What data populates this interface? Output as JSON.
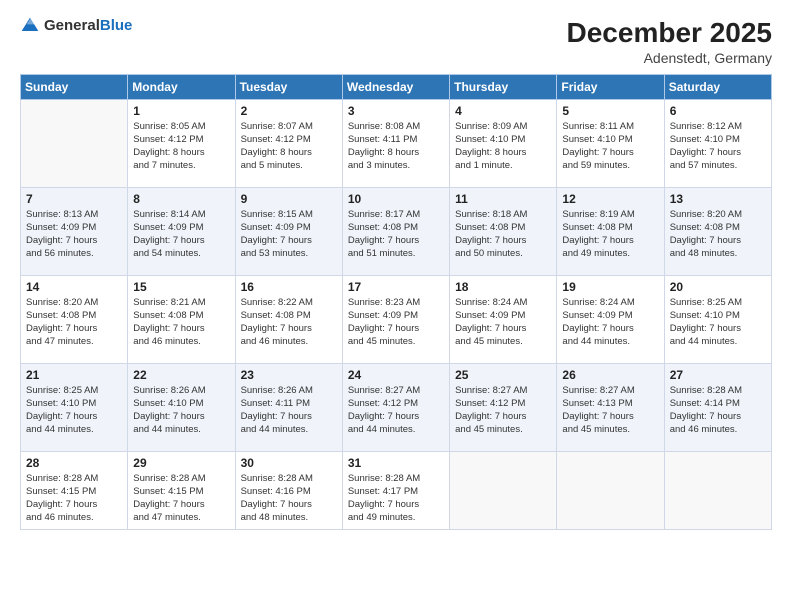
{
  "header": {
    "logo_general": "General",
    "logo_blue": "Blue",
    "title": "December 2025",
    "subtitle": "Adenstedt, Germany"
  },
  "days_of_week": [
    "Sunday",
    "Monday",
    "Tuesday",
    "Wednesday",
    "Thursday",
    "Friday",
    "Saturday"
  ],
  "weeks": [
    [
      {
        "day": "",
        "info": ""
      },
      {
        "day": "1",
        "info": "Sunrise: 8:05 AM\nSunset: 4:12 PM\nDaylight: 8 hours\nand 7 minutes."
      },
      {
        "day": "2",
        "info": "Sunrise: 8:07 AM\nSunset: 4:12 PM\nDaylight: 8 hours\nand 5 minutes."
      },
      {
        "day": "3",
        "info": "Sunrise: 8:08 AM\nSunset: 4:11 PM\nDaylight: 8 hours\nand 3 minutes."
      },
      {
        "day": "4",
        "info": "Sunrise: 8:09 AM\nSunset: 4:10 PM\nDaylight: 8 hours\nand 1 minute."
      },
      {
        "day": "5",
        "info": "Sunrise: 8:11 AM\nSunset: 4:10 PM\nDaylight: 7 hours\nand 59 minutes."
      },
      {
        "day": "6",
        "info": "Sunrise: 8:12 AM\nSunset: 4:10 PM\nDaylight: 7 hours\nand 57 minutes."
      }
    ],
    [
      {
        "day": "7",
        "info": "Sunrise: 8:13 AM\nSunset: 4:09 PM\nDaylight: 7 hours\nand 56 minutes."
      },
      {
        "day": "8",
        "info": "Sunrise: 8:14 AM\nSunset: 4:09 PM\nDaylight: 7 hours\nand 54 minutes."
      },
      {
        "day": "9",
        "info": "Sunrise: 8:15 AM\nSunset: 4:09 PM\nDaylight: 7 hours\nand 53 minutes."
      },
      {
        "day": "10",
        "info": "Sunrise: 8:17 AM\nSunset: 4:08 PM\nDaylight: 7 hours\nand 51 minutes."
      },
      {
        "day": "11",
        "info": "Sunrise: 8:18 AM\nSunset: 4:08 PM\nDaylight: 7 hours\nand 50 minutes."
      },
      {
        "day": "12",
        "info": "Sunrise: 8:19 AM\nSunset: 4:08 PM\nDaylight: 7 hours\nand 49 minutes."
      },
      {
        "day": "13",
        "info": "Sunrise: 8:20 AM\nSunset: 4:08 PM\nDaylight: 7 hours\nand 48 minutes."
      }
    ],
    [
      {
        "day": "14",
        "info": "Sunrise: 8:20 AM\nSunset: 4:08 PM\nDaylight: 7 hours\nand 47 minutes."
      },
      {
        "day": "15",
        "info": "Sunrise: 8:21 AM\nSunset: 4:08 PM\nDaylight: 7 hours\nand 46 minutes."
      },
      {
        "day": "16",
        "info": "Sunrise: 8:22 AM\nSunset: 4:08 PM\nDaylight: 7 hours\nand 46 minutes."
      },
      {
        "day": "17",
        "info": "Sunrise: 8:23 AM\nSunset: 4:09 PM\nDaylight: 7 hours\nand 45 minutes."
      },
      {
        "day": "18",
        "info": "Sunrise: 8:24 AM\nSunset: 4:09 PM\nDaylight: 7 hours\nand 45 minutes."
      },
      {
        "day": "19",
        "info": "Sunrise: 8:24 AM\nSunset: 4:09 PM\nDaylight: 7 hours\nand 44 minutes."
      },
      {
        "day": "20",
        "info": "Sunrise: 8:25 AM\nSunset: 4:10 PM\nDaylight: 7 hours\nand 44 minutes."
      }
    ],
    [
      {
        "day": "21",
        "info": "Sunrise: 8:25 AM\nSunset: 4:10 PM\nDaylight: 7 hours\nand 44 minutes."
      },
      {
        "day": "22",
        "info": "Sunrise: 8:26 AM\nSunset: 4:10 PM\nDaylight: 7 hours\nand 44 minutes."
      },
      {
        "day": "23",
        "info": "Sunrise: 8:26 AM\nSunset: 4:11 PM\nDaylight: 7 hours\nand 44 minutes."
      },
      {
        "day": "24",
        "info": "Sunrise: 8:27 AM\nSunset: 4:12 PM\nDaylight: 7 hours\nand 44 minutes."
      },
      {
        "day": "25",
        "info": "Sunrise: 8:27 AM\nSunset: 4:12 PM\nDaylight: 7 hours\nand 45 minutes."
      },
      {
        "day": "26",
        "info": "Sunrise: 8:27 AM\nSunset: 4:13 PM\nDaylight: 7 hours\nand 45 minutes."
      },
      {
        "day": "27",
        "info": "Sunrise: 8:28 AM\nSunset: 4:14 PM\nDaylight: 7 hours\nand 46 minutes."
      }
    ],
    [
      {
        "day": "28",
        "info": "Sunrise: 8:28 AM\nSunset: 4:15 PM\nDaylight: 7 hours\nand 46 minutes."
      },
      {
        "day": "29",
        "info": "Sunrise: 8:28 AM\nSunset: 4:15 PM\nDaylight: 7 hours\nand 47 minutes."
      },
      {
        "day": "30",
        "info": "Sunrise: 8:28 AM\nSunset: 4:16 PM\nDaylight: 7 hours\nand 48 minutes."
      },
      {
        "day": "31",
        "info": "Sunrise: 8:28 AM\nSunset: 4:17 PM\nDaylight: 7 hours\nand 49 minutes."
      },
      {
        "day": "",
        "info": ""
      },
      {
        "day": "",
        "info": ""
      },
      {
        "day": "",
        "info": ""
      }
    ]
  ]
}
